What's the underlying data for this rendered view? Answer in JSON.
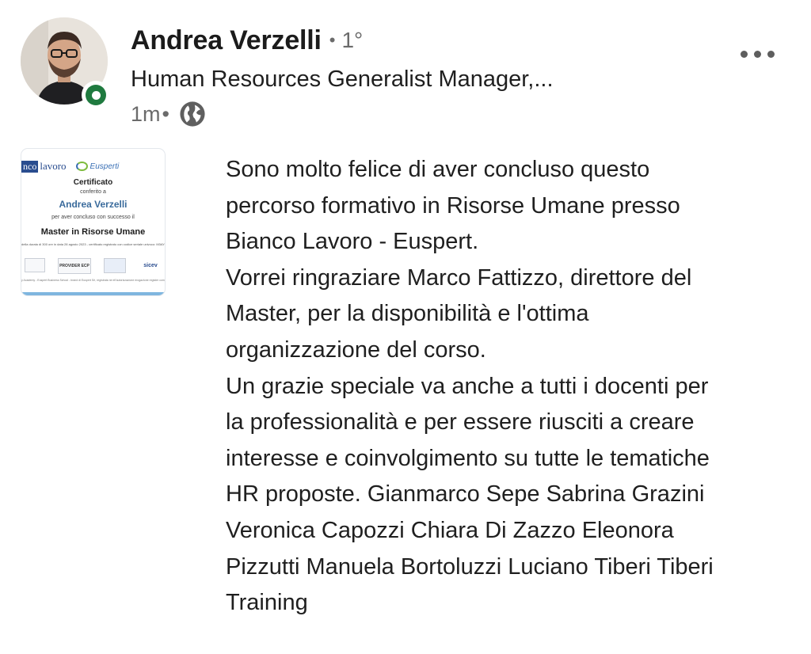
{
  "post": {
    "author": {
      "name": "Andrea Verzelli",
      "degree_separator": "•",
      "degree": "1°",
      "headline": "Human Resources Generalist Manager,...",
      "status": "online"
    },
    "meta": {
      "time": "1m",
      "separator": "•",
      "visibility_icon": "globe-icon"
    },
    "menu": {
      "icon": "more-horizontal-icon"
    },
    "attachment": {
      "type": "certificate-image",
      "logo_left_box": "nco",
      "logo_left": "lavoro",
      "logo_right": "Eusperti",
      "title": "Certificato",
      "conferred": "conferito a",
      "recipient": "Andrea Verzelli",
      "reason": "per aver concluso con successo il",
      "course": "Master in Risorse Umane",
      "details": "della durata di 300 ore in data 28 agosto 2023 - certificato registrato con codice seriale univoco: M3AYH",
      "footer": "y Academy - Euspert Business School - brand di Euspert Srl, registrata ne ell'autorizzazione erogazione register companies number 37289 - P. IVA 46829156 - VAT: IN25S37363 - European Union Serv",
      "badge_provider": "PROVIDER ECP",
      "badge_sicev": "sicev"
    },
    "text_lines": [
      "Sono molto felice di aver concluso questo",
      "percorso formativo in Risorse Umane presso",
      "Bianco Lavoro - Euspert.",
      "Vorrei ringraziare Marco Fattizzo, direttore del",
      "Master, per la disponibilità e l'ottima",
      "organizzazione del corso.",
      "Un grazie speciale va anche a tutti i docenti per",
      "la professionalità e per essere riusciti a creare",
      "interesse e coinvolgimento su tutte le tematiche",
      "HR proposte. Gianmarco Sepe Sabrina Grazini",
      "Veronica Capozzi Chiara Di Zazzo Eleonora",
      "Pizzutti Manuela Bortoluzzi Luciano Tiberi Tiberi",
      "Training"
    ]
  }
}
